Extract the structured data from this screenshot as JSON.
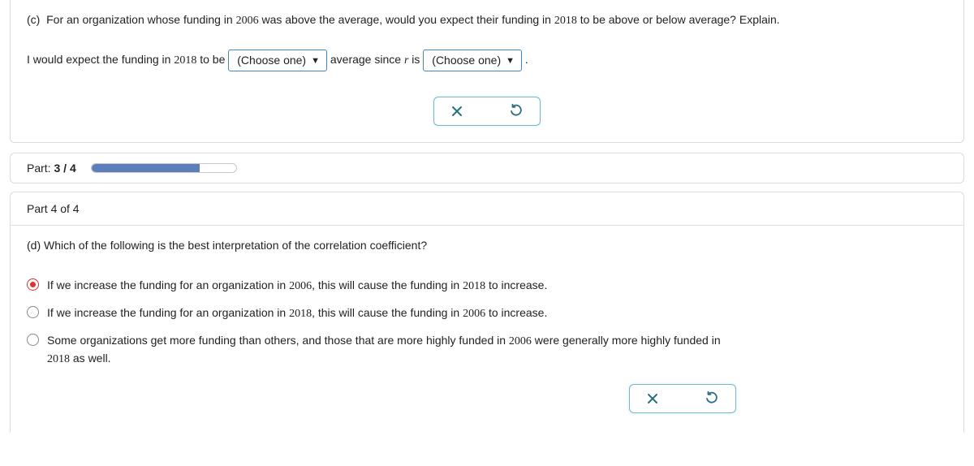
{
  "part_c": {
    "prefix": "(c)",
    "q1a": "For an organization whose funding in ",
    "year1": "2006",
    "q1b": " was above the average, would you expect their funding in ",
    "year2": "2018",
    "q1c": " to be above or below average? Explain.",
    "a1a": "I would expect the funding in ",
    "a_year": "2018",
    "a1b": " to be ",
    "dd1": "(Choose one)",
    "a1c": " average since ",
    "rvar": "r",
    "a1d": " is ",
    "dd2": "(Choose one)",
    "a1e": " ."
  },
  "progress": {
    "label_prefix": "Part: ",
    "current": "3",
    "sep": " / ",
    "total": "4",
    "fill_pct": 75
  },
  "part_d": {
    "header": "Part 4 of 4",
    "prefix": "(d)",
    "question": "Which of the following is the best interpretation of the correlation coefficient?",
    "options": [
      {
        "pre": "If we increase the funding for an organization in ",
        "y1": "2006",
        "mid": ", this will cause the funding in ",
        "y2": "2018",
        "post": " to increase.",
        "selected": true
      },
      {
        "pre": "If we increase the funding for an organization in ",
        "y1": "2018",
        "mid": ", this will cause the funding in ",
        "y2": "2006",
        "post": " to increase.",
        "selected": false
      },
      {
        "pre": "Some organizations get more funding than others, and those that are more highly funded in ",
        "y1": "2006",
        "mid": " were generally more highly funded in ",
        "y2": "2018",
        "post": " as well.",
        "selected": false
      }
    ]
  },
  "icons": {
    "close": "close-icon",
    "undo": "undo-icon",
    "tri": "▼"
  }
}
